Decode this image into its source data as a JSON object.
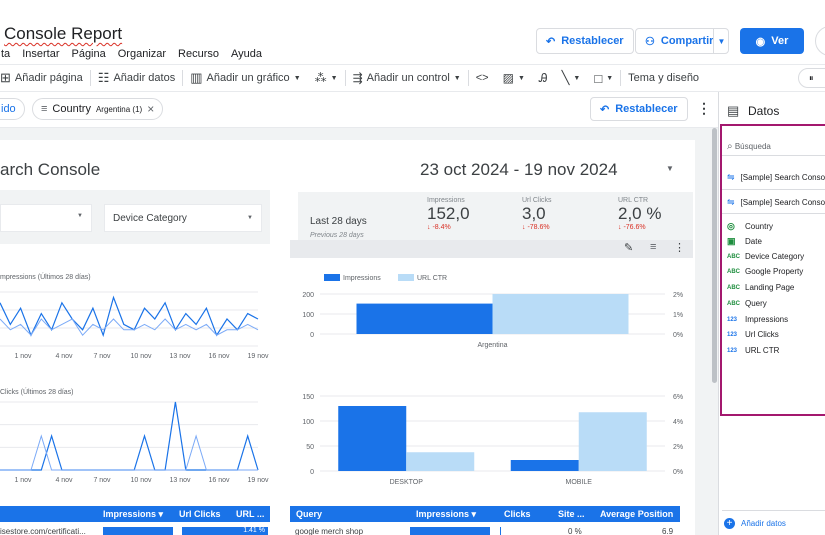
{
  "header": {
    "title": "Console Report",
    "menu": [
      "ta",
      "Insertar",
      "Página",
      "Organizar",
      "Recurso",
      "Ayuda"
    ],
    "restablecer_label": "Restablecer",
    "compartir_label": "Compartir",
    "ver_label": "Ver"
  },
  "toolbar": {
    "add_page": "Añadir página",
    "add_data": "Añadir datos",
    "add_chart": "Añadir un gráfico",
    "add_control": "Añadir un control",
    "theme": "Tema y diseño"
  },
  "filterbar": {
    "chip_left": "ido",
    "country_label": "Country",
    "country_value": "Argentina (1)",
    "restablecer_label": "Restablecer"
  },
  "report": {
    "title": "arch Console",
    "date_range": "23 oct 2024 - 19 nov 2024",
    "device_category": "Device Category",
    "scorecard": {
      "period": "Last 28 days",
      "previous": "Previous 28 days",
      "metrics": [
        {
          "label": "Impressions",
          "value": "152,0",
          "delta": "↓ -8.4%"
        },
        {
          "label": "Url Clicks",
          "value": "3,0",
          "delta": "↓ -78.6%"
        },
        {
          "label": "URL CTR",
          "value": "2,0 %",
          "delta": "↓ -76.6%"
        }
      ]
    },
    "line1_title": "mpressions (Últimos 28 días)",
    "line2_title": "Clicks (Últimos 28 días)",
    "x_ticks": [
      "1 nov",
      "4 nov",
      "7 nov",
      "10 nov",
      "13 nov",
      "16 nov",
      "19 nov"
    ]
  },
  "chart_data": [
    {
      "type": "line",
      "title": "mpressions (Últimos 28 días)",
      "series": [
        {
          "values": [
            8,
            4,
            7,
            2,
            6,
            3,
            8,
            5,
            3,
            7,
            2,
            9,
            4,
            3,
            7,
            5,
            8,
            3,
            6,
            4,
            7,
            2,
            5,
            3,
            6,
            5
          ]
        },
        {
          "values": [
            5,
            3,
            4,
            2,
            5,
            3,
            4,
            5,
            2,
            4,
            3,
            5,
            3,
            3,
            4,
            3,
            5,
            3,
            4,
            3,
            4,
            2,
            3,
            3,
            4,
            3
          ]
        }
      ]
    },
    {
      "type": "line",
      "title": "Clicks (Últimos 28 días)",
      "series": [
        {
          "values": [
            0,
            0,
            0,
            0,
            0,
            1,
            0,
            0,
            0,
            0,
            0,
            0,
            0,
            0,
            1,
            0,
            0,
            2,
            0,
            0,
            0,
            0,
            0,
            0,
            1,
            0
          ]
        },
        {
          "values": [
            0,
            0,
            0,
            0,
            1,
            0,
            0,
            0,
            0,
            0,
            0,
            0,
            0,
            0,
            0,
            0,
            0,
            0,
            0,
            1,
            0,
            0,
            0,
            0,
            0,
            0
          ]
        }
      ]
    },
    {
      "type": "bar",
      "categories": [
        "Argentina"
      ],
      "series": [
        {
          "name": "Impressions",
          "values": [
            152
          ]
        },
        {
          "name": "URL CTR",
          "values": [
            0.02
          ]
        }
      ],
      "y_left_ticks": [
        "200",
        "100",
        "0"
      ],
      "y_right_ticks": [
        "2%",
        "1%",
        "0%"
      ],
      "ylim": [
        0,
        200
      ]
    },
    {
      "type": "bar",
      "categories": [
        "DESKTOP",
        "MOBILE"
      ],
      "series": [
        {
          "values": [
            130,
            22
          ]
        },
        {
          "values": [
            0.015,
            0.047
          ]
        }
      ],
      "y_left_ticks": [
        "150",
        "100",
        "50",
        "0"
      ],
      "y_right_ticks": [
        "6%",
        "4%",
        "2%",
        "0%"
      ],
      "ylim": [
        0,
        150
      ]
    }
  ],
  "table1": {
    "headers": [
      "Impressions ▾",
      "Url Clicks",
      "URL ..."
    ],
    "row": [
      "isestore.com/certificati...",
      "",
      "1.41 %"
    ]
  },
  "table2": {
    "headers": [
      "Query",
      "Impressions ▾",
      "Clicks",
      "Site ...",
      "Average Position"
    ],
    "row": [
      "google merch shop",
      "",
      "",
      "0 %",
      "6.9"
    ]
  },
  "datos": {
    "title": "Datos",
    "search_placeholder": "Búsqueda",
    "sources": [
      "[Sample] Search Conso",
      "[Sample] Search Conso"
    ],
    "fields": [
      {
        "type": "geo",
        "name": "Country"
      },
      {
        "type": "date",
        "name": "Date"
      },
      {
        "type": "ABC",
        "name": "Device Category"
      },
      {
        "type": "ABC",
        "name": "Google Property"
      },
      {
        "type": "ABC",
        "name": "Landing Page"
      },
      {
        "type": "ABC",
        "name": "Query"
      },
      {
        "type": "123",
        "name": "Impressions"
      },
      {
        "type": "123",
        "name": "Url Clicks"
      },
      {
        "type": "123",
        "name": "URL CTR"
      }
    ],
    "add_data": "Añadir datos"
  },
  "colors": {
    "accent": "#1a73e8",
    "light_blue": "#b9dcf7",
    "negative": "#d93025",
    "highlight": "#a3186e"
  }
}
